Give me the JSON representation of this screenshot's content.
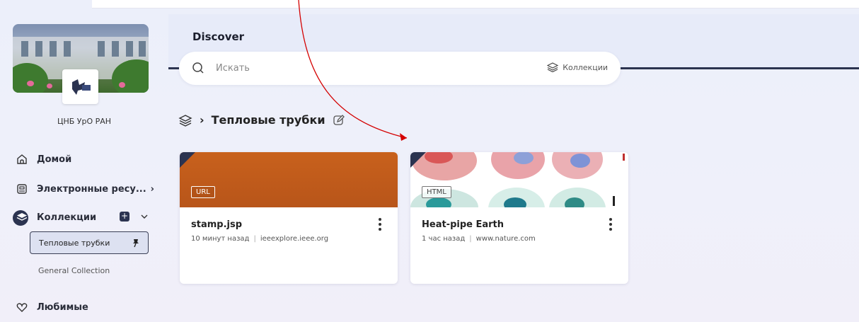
{
  "header": {
    "title": "Discover"
  },
  "search": {
    "placeholder": "Искать",
    "collections_label": "Коллекции"
  },
  "sidebar": {
    "org_name": "ЦНБ УрО РАН",
    "items": [
      {
        "label": "Домой",
        "icon": "home-icon"
      },
      {
        "label": "Электронные ресу...",
        "icon": "library-icon"
      },
      {
        "label": "Коллекции",
        "icon": "layers-icon"
      },
      {
        "label": "Любимые",
        "icon": "heart-icon"
      }
    ],
    "collections": [
      {
        "label": "Тепловые трубки",
        "selected": true
      },
      {
        "label": "General Collection",
        "selected": false
      }
    ]
  },
  "breadcrumb": {
    "current": "Тепловые трубки"
  },
  "cards": [
    {
      "type": "URL",
      "title": "stamp.jsp",
      "time": "10 минут назад",
      "source": "ieeexplore.ieee.org",
      "thumb_color": "#c45e1c"
    },
    {
      "type": "HTML",
      "title": "Heat-pipe Earth",
      "time": "1 час назад",
      "source": "www.nature.com"
    }
  ],
  "colors": {
    "accent": "#2b3350",
    "annotation_arrow": "#d40000"
  }
}
